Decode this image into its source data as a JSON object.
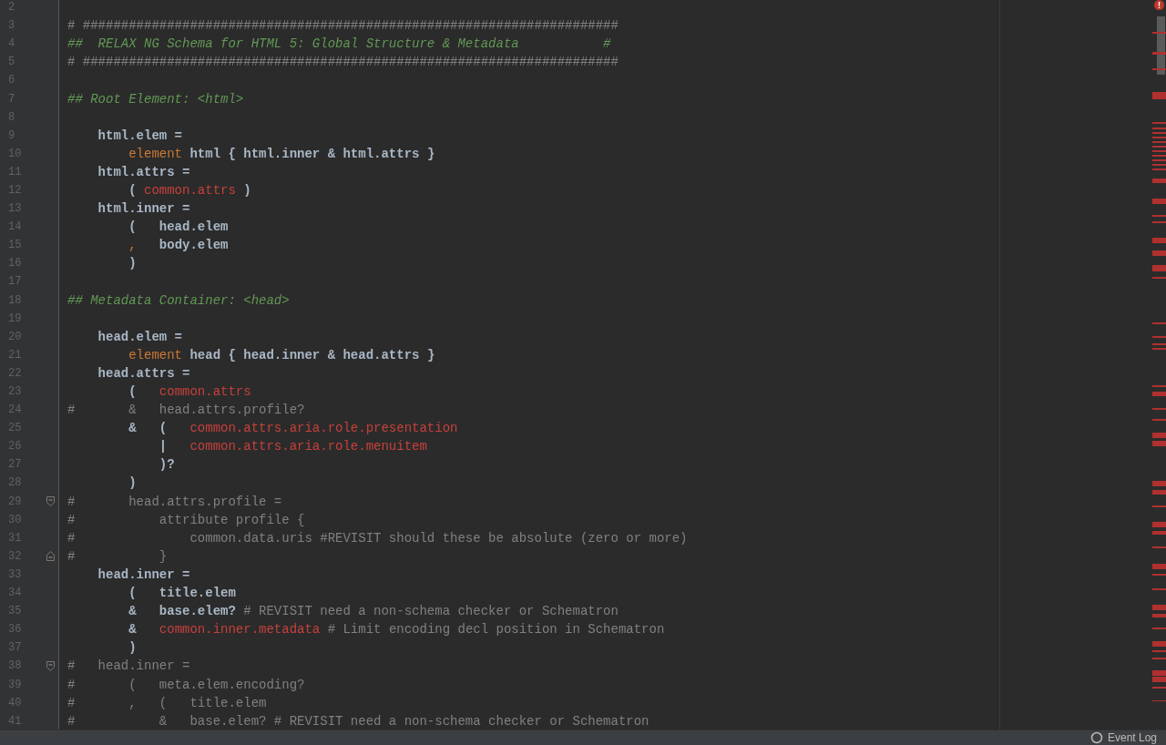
{
  "editor": {
    "lines": [
      {
        "number": "2",
        "fold_start": false,
        "fold_end": false
      },
      {
        "number": "3",
        "fold_start": false,
        "fold_end": false,
        "tokens": [
          {
            "kind": "comment",
            "text": "# ######################################################################"
          }
        ]
      },
      {
        "number": "4",
        "fold_start": false,
        "fold_end": false,
        "tokens": [
          {
            "kind": "doc_comment",
            "text": "##  RELAX NG Schema for HTML 5: Global Structure & Metadata           #"
          }
        ]
      },
      {
        "number": "5",
        "fold_start": false,
        "fold_end": false,
        "tokens": [
          {
            "kind": "comment",
            "text": "# ######################################################################"
          }
        ]
      },
      {
        "number": "6",
        "fold_start": false,
        "fold_end": false
      },
      {
        "number": "7",
        "fold_start": false,
        "fold_end": false,
        "tokens": [
          {
            "kind": "doc_comment",
            "text": "## Root Element: <html>"
          }
        ]
      },
      {
        "number": "8",
        "fold_start": false,
        "fold_end": false
      },
      {
        "number": "9",
        "fold_start": false,
        "fold_end": false,
        "tokens": [
          {
            "kind": "code",
            "text": "    html.elem ="
          }
        ]
      },
      {
        "number": "10",
        "fold_start": false,
        "fold_end": false,
        "tokens": [
          {
            "kind": "keyword",
            "text": "        element"
          },
          {
            "kind": "code",
            "text": " html { html.inner & html.attrs }"
          }
        ]
      },
      {
        "number": "11",
        "fold_start": false,
        "fold_end": false,
        "tokens": [
          {
            "kind": "code",
            "text": "    html.attrs ="
          }
        ]
      },
      {
        "number": "12",
        "fold_start": false,
        "fold_end": false,
        "tokens": [
          {
            "kind": "code",
            "text": "        ( "
          },
          {
            "kind": "reference",
            "text": "common.attrs"
          },
          {
            "kind": "code",
            "text": " )"
          }
        ]
      },
      {
        "number": "13",
        "fold_start": false,
        "fold_end": false,
        "tokens": [
          {
            "kind": "code",
            "text": "    html.inner ="
          }
        ]
      },
      {
        "number": "14",
        "fold_start": false,
        "fold_end": false,
        "tokens": [
          {
            "kind": "code",
            "text": "        (   head.elem"
          }
        ]
      },
      {
        "number": "15",
        "fold_start": false,
        "fold_end": false,
        "tokens": [
          {
            "kind": "separator",
            "text": "        ,"
          },
          {
            "kind": "code",
            "text": "   body.elem"
          }
        ]
      },
      {
        "number": "16",
        "fold_start": false,
        "fold_end": false,
        "tokens": [
          {
            "kind": "code",
            "text": "        )"
          }
        ]
      },
      {
        "number": "17",
        "fold_start": false,
        "fold_end": false
      },
      {
        "number": "18",
        "fold_start": false,
        "fold_end": false,
        "tokens": [
          {
            "kind": "doc_comment",
            "text": "## Metadata Container: <head>"
          }
        ]
      },
      {
        "number": "19",
        "fold_start": false,
        "fold_end": false
      },
      {
        "number": "20",
        "fold_start": false,
        "fold_end": false,
        "tokens": [
          {
            "kind": "code",
            "text": "    head.elem ="
          }
        ]
      },
      {
        "number": "21",
        "fold_start": false,
        "fold_end": false,
        "tokens": [
          {
            "kind": "keyword",
            "text": "        element"
          },
          {
            "kind": "code",
            "text": " head { head.inner & head.attrs }"
          }
        ]
      },
      {
        "number": "22",
        "fold_start": false,
        "fold_end": false,
        "tokens": [
          {
            "kind": "code",
            "text": "    head.attrs ="
          }
        ]
      },
      {
        "number": "23",
        "fold_start": false,
        "fold_end": false,
        "tokens": [
          {
            "kind": "code",
            "text": "        (   "
          },
          {
            "kind": "reference",
            "text": "common.attrs"
          }
        ]
      },
      {
        "number": "24",
        "fold_start": false,
        "fold_end": false,
        "tokens": [
          {
            "kind": "comment",
            "text": "#       &   head.attrs.profile?"
          }
        ]
      },
      {
        "number": "25",
        "fold_start": false,
        "fold_end": false,
        "tokens": [
          {
            "kind": "code",
            "text": "        &   (   "
          },
          {
            "kind": "reference",
            "text": "common.attrs.aria.role.presentation"
          }
        ]
      },
      {
        "number": "26",
        "fold_start": false,
        "fold_end": false,
        "tokens": [
          {
            "kind": "code",
            "text": "            |   "
          },
          {
            "kind": "reference",
            "text": "common.attrs.aria.role.menuitem"
          }
        ]
      },
      {
        "number": "27",
        "fold_start": false,
        "fold_end": false,
        "tokens": [
          {
            "kind": "code",
            "text": "            )?"
          }
        ]
      },
      {
        "number": "28",
        "fold_start": false,
        "fold_end": false,
        "tokens": [
          {
            "kind": "code",
            "text": "        )"
          }
        ]
      },
      {
        "number": "29",
        "fold_start": true,
        "fold_end": false,
        "tokens": [
          {
            "kind": "comment",
            "text": "#       head.attrs.profile ="
          }
        ]
      },
      {
        "number": "30",
        "fold_start": false,
        "fold_end": false,
        "tokens": [
          {
            "kind": "comment",
            "text": "#           attribute profile {"
          }
        ]
      },
      {
        "number": "31",
        "fold_start": false,
        "fold_end": false,
        "tokens": [
          {
            "kind": "comment",
            "text": "#               common.data.uris #REVISIT should these be absolute (zero or more)"
          }
        ]
      },
      {
        "number": "32",
        "fold_start": false,
        "fold_end": true,
        "tokens": [
          {
            "kind": "comment",
            "text": "#           }"
          }
        ]
      },
      {
        "number": "33",
        "fold_start": false,
        "fold_end": false,
        "tokens": [
          {
            "kind": "code",
            "text": "    head.inner ="
          }
        ]
      },
      {
        "number": "34",
        "fold_start": false,
        "fold_end": false,
        "tokens": [
          {
            "kind": "code",
            "text": "        (   title.elem"
          }
        ]
      },
      {
        "number": "35",
        "fold_start": false,
        "fold_end": false,
        "tokens": [
          {
            "kind": "code",
            "text": "        &   base.elem? "
          },
          {
            "kind": "comment",
            "text": "# REVISIT need a non-schema checker or Schematron"
          }
        ]
      },
      {
        "number": "36",
        "fold_start": false,
        "fold_end": false,
        "tokens": [
          {
            "kind": "code",
            "text": "        &   "
          },
          {
            "kind": "reference",
            "text": "common.inner.metadata"
          },
          {
            "kind": "comment",
            "text": " # Limit encoding decl position in Schematron"
          }
        ]
      },
      {
        "number": "37",
        "fold_start": false,
        "fold_end": false,
        "tokens": [
          {
            "kind": "code",
            "text": "        )"
          }
        ]
      },
      {
        "number": "38",
        "fold_start": true,
        "fold_end": false,
        "tokens": [
          {
            "kind": "comment",
            "text": "#   head.inner ="
          }
        ]
      },
      {
        "number": "39",
        "fold_start": false,
        "fold_end": false,
        "tokens": [
          {
            "kind": "comment",
            "text": "#       (   meta.elem.encoding?"
          }
        ]
      },
      {
        "number": "40",
        "fold_start": false,
        "fold_end": false,
        "tokens": [
          {
            "kind": "comment",
            "text": "#       ,   (   title.elem"
          }
        ]
      },
      {
        "number": "41",
        "fold_start": false,
        "fold_end": false,
        "tokens": [
          {
            "kind": "comment",
            "text": "#           &   base.elem? # REVISIT need a non-schema checker or Schematron"
          }
        ]
      }
    ]
  },
  "status_bar": {
    "event_log": "Event Log"
  }
}
